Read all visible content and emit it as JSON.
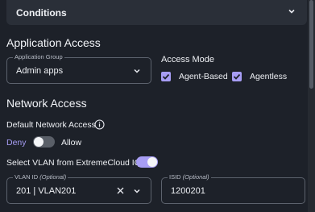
{
  "conditions": {
    "label": "Conditions"
  },
  "application_access": {
    "title": "Application Access",
    "application_group": {
      "label": "Application Group",
      "value": "Admin apps"
    },
    "access_mode": {
      "label": "Access Mode",
      "options": [
        {
          "label": "Agent-Based",
          "checked": true
        },
        {
          "label": "Agentless",
          "checked": true
        }
      ]
    }
  },
  "network_access": {
    "title": "Network Access",
    "default_label": "Default Network Access",
    "deny_label": "Deny",
    "allow_label": "Allow",
    "default_on": false,
    "select_vlan_label": "Select VLAN from ExtremeCloud IQ",
    "select_vlan_on": true,
    "vlan_id": {
      "label": "VLAN ID",
      "optional": "(Optional)",
      "value": "201 | VLAN201"
    },
    "isid": {
      "label": "ISID",
      "optional": "(Optional)",
      "value": "1200201"
    }
  },
  "colors": {
    "accent": "#a79df4",
    "background": "#1d2129"
  }
}
